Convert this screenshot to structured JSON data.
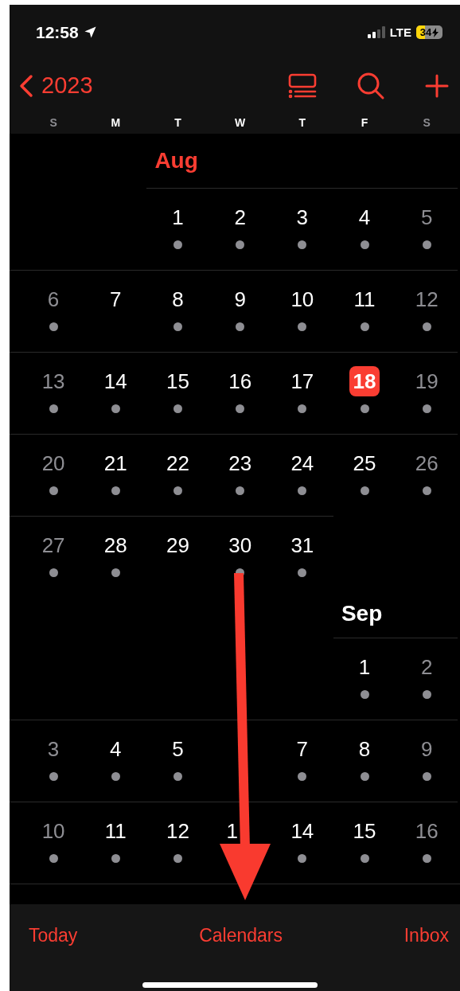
{
  "status_bar": {
    "time": "12:58",
    "network": "LTE",
    "battery": "34",
    "battery_level": {
      "level": 0.34
    }
  },
  "nav": {
    "back_label": "2023"
  },
  "weekdays": [
    "S",
    "M",
    "T",
    "W",
    "T",
    "F",
    "S"
  ],
  "months": [
    {
      "name": "Aug",
      "current": true,
      "weeks": [
        [
          {
            "kind": "blank"
          },
          {
            "kind": "blank"
          },
          {
            "kind": "day",
            "day": "1",
            "events": true,
            "today": false
          },
          {
            "kind": "day",
            "day": "2",
            "events": true,
            "today": false
          },
          {
            "kind": "day",
            "day": "3",
            "events": true,
            "today": false
          },
          {
            "kind": "day",
            "day": "4",
            "events": true,
            "today": false
          },
          {
            "kind": "day",
            "day": "5",
            "events": true,
            "today": false
          }
        ],
        [
          {
            "kind": "day",
            "day": "6",
            "events": true,
            "today": false
          },
          {
            "kind": "day",
            "day": "7",
            "events": false,
            "today": false
          },
          {
            "kind": "day",
            "day": "8",
            "events": true,
            "today": false
          },
          {
            "kind": "day",
            "day": "9",
            "events": true,
            "today": false
          },
          {
            "kind": "day",
            "day": "10",
            "events": true,
            "today": false
          },
          {
            "kind": "day",
            "day": "11",
            "events": true,
            "today": false
          },
          {
            "kind": "day",
            "day": "12",
            "events": true,
            "today": false
          }
        ],
        [
          {
            "kind": "day",
            "day": "13",
            "events": true,
            "today": false
          },
          {
            "kind": "day",
            "day": "14",
            "events": true,
            "today": false
          },
          {
            "kind": "day",
            "day": "15",
            "events": true,
            "today": false
          },
          {
            "kind": "day",
            "day": "16",
            "events": true,
            "today": false
          },
          {
            "kind": "day",
            "day": "17",
            "events": true,
            "today": false
          },
          {
            "kind": "day",
            "day": "18",
            "events": true,
            "today": true
          },
          {
            "kind": "day",
            "day": "19",
            "events": true,
            "today": false
          }
        ],
        [
          {
            "kind": "day",
            "day": "20",
            "events": true,
            "today": false
          },
          {
            "kind": "day",
            "day": "21",
            "events": true,
            "today": false
          },
          {
            "kind": "day",
            "day": "22",
            "events": true,
            "today": false
          },
          {
            "kind": "day",
            "day": "23",
            "events": true,
            "today": false
          },
          {
            "kind": "day",
            "day": "24",
            "events": true,
            "today": false
          },
          {
            "kind": "day",
            "day": "25",
            "events": true,
            "today": false
          },
          {
            "kind": "day",
            "day": "26",
            "events": true,
            "today": false
          }
        ],
        [
          {
            "kind": "day",
            "day": "27",
            "events": true,
            "today": false
          },
          {
            "kind": "day",
            "day": "28",
            "events": true,
            "today": false
          },
          {
            "kind": "day",
            "day": "29",
            "events": false,
            "today": false
          },
          {
            "kind": "day",
            "day": "30",
            "events": true,
            "today": false
          },
          {
            "kind": "day",
            "day": "31",
            "events": true,
            "today": false
          },
          {
            "kind": "blank"
          },
          {
            "kind": "blank"
          }
        ]
      ]
    },
    {
      "name": "Sep",
      "current": false,
      "weeks": [
        [
          {
            "kind": "blank"
          },
          {
            "kind": "blank"
          },
          {
            "kind": "blank"
          },
          {
            "kind": "blank"
          },
          {
            "kind": "blank"
          },
          {
            "kind": "day",
            "day": "1",
            "events": true,
            "today": false
          },
          {
            "kind": "day",
            "day": "2",
            "events": true,
            "today": false
          }
        ],
        [
          {
            "kind": "day",
            "day": "3",
            "events": true,
            "today": false
          },
          {
            "kind": "day",
            "day": "4",
            "events": true,
            "today": false
          },
          {
            "kind": "day",
            "day": "5",
            "events": true,
            "today": false
          },
          {
            "kind": "covered"
          },
          {
            "kind": "day",
            "day": "7",
            "events": true,
            "today": false
          },
          {
            "kind": "day",
            "day": "8",
            "events": true,
            "today": false
          },
          {
            "kind": "day",
            "day": "9",
            "events": true,
            "today": false
          }
        ],
        [
          {
            "kind": "day",
            "day": "10",
            "events": true,
            "today": false
          },
          {
            "kind": "day",
            "day": "11",
            "events": true,
            "today": false
          },
          {
            "kind": "day",
            "day": "12",
            "events": true,
            "today": false
          },
          {
            "kind": "partial",
            "day": "1",
            "today": false
          },
          {
            "kind": "day",
            "day": "14",
            "events": true,
            "today": false
          },
          {
            "kind": "day",
            "day": "15",
            "events": true,
            "today": false
          },
          {
            "kind": "day",
            "day": "16",
            "events": true,
            "today": false
          }
        ]
      ]
    }
  ],
  "tab_bar": [
    "Today",
    "Calendars",
    "Inbox"
  ]
}
